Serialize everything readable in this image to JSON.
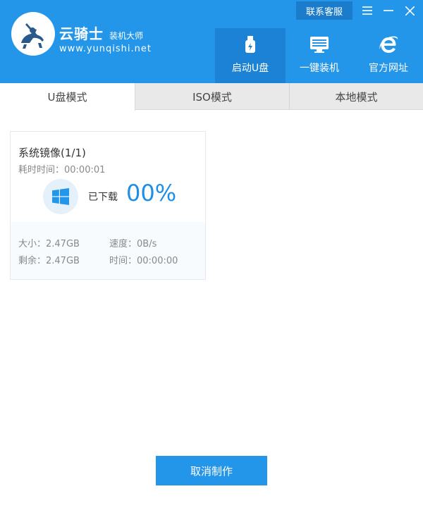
{
  "header": {
    "brand_name": "云骑士",
    "brand_sub": "装机大师",
    "brand_url": "www.yunqishi.net",
    "service_label": "联系客服",
    "nav": [
      {
        "label": "启动U盘",
        "icon": "usb-drive-icon",
        "active": true
      },
      {
        "label": "一键装机",
        "icon": "monitor-icon",
        "active": false
      },
      {
        "label": "官方网址",
        "icon": "browser-e-icon",
        "active": false
      }
    ]
  },
  "tabs": [
    {
      "label": "U盘模式",
      "active": true
    },
    {
      "label": "ISO模式",
      "active": false
    },
    {
      "label": "本地模式",
      "active": false
    }
  ],
  "card": {
    "title": "系统镜像(1/1)",
    "elapsed": "耗时时间：00:00:01",
    "downloaded_label": "已下载",
    "percent": "00%",
    "size": "大小：2.47GB",
    "speed": "速度：0B/s",
    "remaining": "剩余：2.47GB",
    "time": "时间：00:00:00"
  },
  "cancel_label": "取消制作",
  "colors": {
    "accent": "#2496ea",
    "accent_dark": "#1b82d6",
    "percent": "#1f8ee6"
  }
}
